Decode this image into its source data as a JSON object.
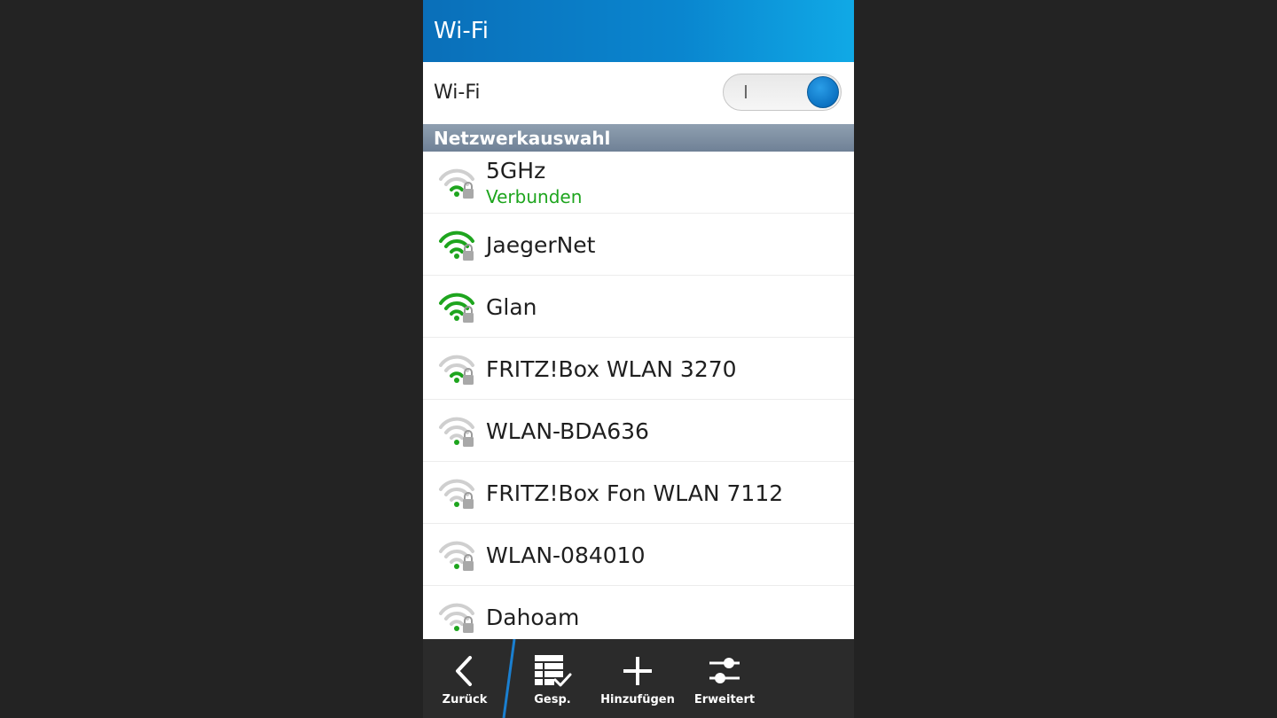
{
  "header": {
    "title": "Wi-Fi"
  },
  "wifi_toggle": {
    "label": "Wi-Fi",
    "state_mark": "I",
    "on": true
  },
  "section": {
    "title": "Netzwerkauswahl"
  },
  "networks": [
    {
      "name": "5GHz",
      "status": "Verbunden",
      "signal_bars": 1,
      "secured": true
    },
    {
      "name": "JaegerNet",
      "status": "",
      "signal_bars": 3,
      "secured": true
    },
    {
      "name": "Glan",
      "status": "",
      "signal_bars": 3,
      "secured": true
    },
    {
      "name": "FRITZ!Box WLAN 3270",
      "status": "",
      "signal_bars": 1,
      "secured": true
    },
    {
      "name": "WLAN-BDA636",
      "status": "",
      "signal_bars": 0,
      "secured": true
    },
    {
      "name": "FRITZ!Box Fon WLAN 7112",
      "status": "",
      "signal_bars": 0,
      "secured": true
    },
    {
      "name": "WLAN-084010",
      "status": "",
      "signal_bars": 0,
      "secured": true
    },
    {
      "name": "Dahoam",
      "status": "",
      "signal_bars": 0,
      "secured": true
    }
  ],
  "toolbar": {
    "back": {
      "label": "Zurück",
      "icon": "chevron-left-icon"
    },
    "saved": {
      "label": "Gesp.",
      "icon": "saved-list-icon"
    },
    "add": {
      "label": "Hinzufügen",
      "icon": "plus-icon"
    },
    "advanced": {
      "label": "Erweitert",
      "icon": "sliders-icon"
    }
  },
  "colors": {
    "header_blue": "#0a86cf",
    "toggle_knob": "#0c72c2",
    "signal_green": "#1ea51e",
    "signal_grey": "#cfcfcf",
    "accent_divider": "#1a7fd0"
  }
}
